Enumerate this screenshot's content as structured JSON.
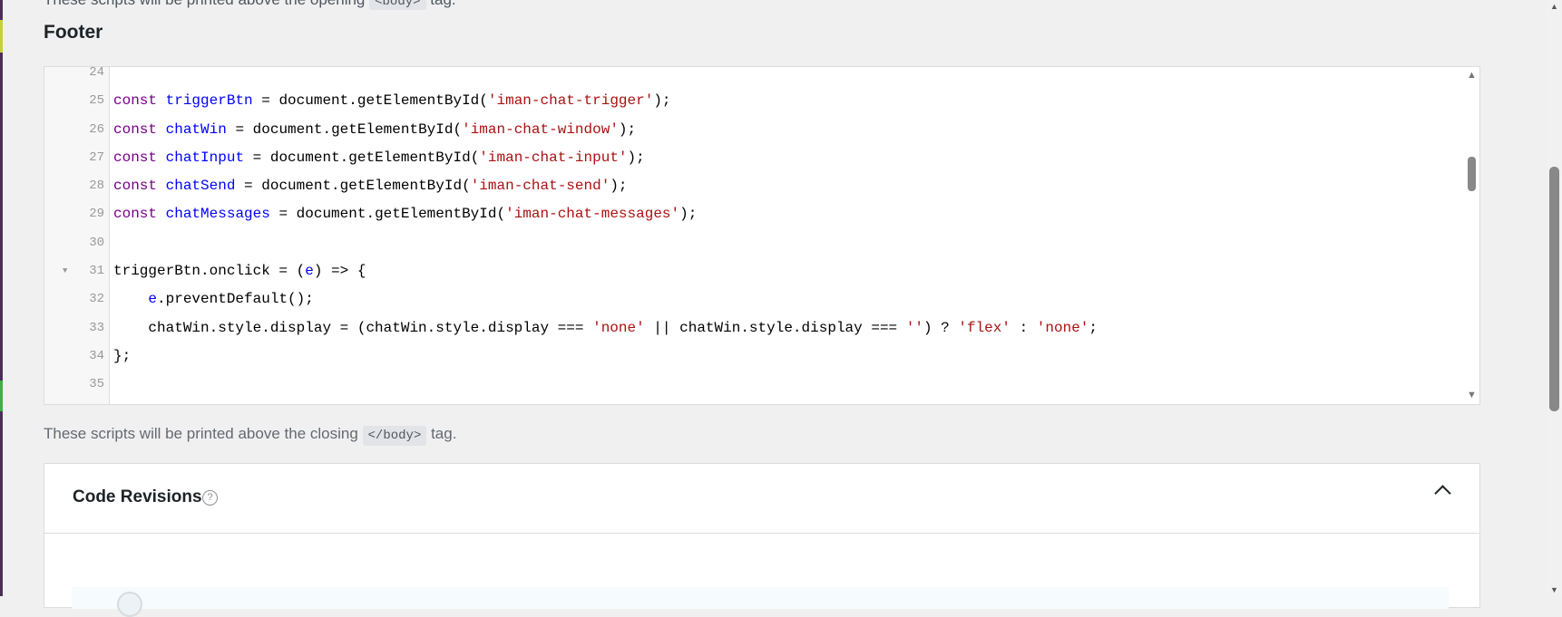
{
  "top_partial": {
    "text": "These scripts will be printed above the opening",
    "code": "<body>",
    "suffix": "tag."
  },
  "section_title": "Footer",
  "editor": {
    "lines": [
      {
        "num": "24",
        "fold": false,
        "tokens": []
      },
      {
        "num": "25",
        "fold": false,
        "tokens": [
          {
            "t": "const",
            "c": "kw"
          },
          {
            "t": " "
          },
          {
            "t": "triggerBtn",
            "c": "def"
          },
          {
            "t": " = document.getElementById("
          },
          {
            "t": "'iman-chat-trigger'",
            "c": "str"
          },
          {
            "t": ");"
          }
        ]
      },
      {
        "num": "26",
        "fold": false,
        "tokens": [
          {
            "t": "const",
            "c": "kw"
          },
          {
            "t": " "
          },
          {
            "t": "chatWin",
            "c": "def"
          },
          {
            "t": " = document.getElementById("
          },
          {
            "t": "'iman-chat-window'",
            "c": "str"
          },
          {
            "t": ");"
          }
        ]
      },
      {
        "num": "27",
        "fold": false,
        "tokens": [
          {
            "t": "const",
            "c": "kw"
          },
          {
            "t": " "
          },
          {
            "t": "chatInput",
            "c": "def"
          },
          {
            "t": " = document.getElementById("
          },
          {
            "t": "'iman-chat-input'",
            "c": "str"
          },
          {
            "t": ");"
          }
        ]
      },
      {
        "num": "28",
        "fold": false,
        "tokens": [
          {
            "t": "const",
            "c": "kw"
          },
          {
            "t": " "
          },
          {
            "t": "chatSend",
            "c": "def"
          },
          {
            "t": " = document.getElementById("
          },
          {
            "t": "'iman-chat-send'",
            "c": "str"
          },
          {
            "t": ");"
          }
        ]
      },
      {
        "num": "29",
        "fold": false,
        "tokens": [
          {
            "t": "const",
            "c": "kw"
          },
          {
            "t": " "
          },
          {
            "t": "chatMessages",
            "c": "def"
          },
          {
            "t": " = document.getElementById("
          },
          {
            "t": "'iman-chat-messages'",
            "c": "str"
          },
          {
            "t": ");"
          }
        ]
      },
      {
        "num": "30",
        "fold": false,
        "tokens": []
      },
      {
        "num": "31",
        "fold": true,
        "tokens": [
          {
            "t": "triggerBtn.onclick = ("
          },
          {
            "t": "e",
            "c": "def"
          },
          {
            "t": ") => {"
          }
        ]
      },
      {
        "num": "32",
        "fold": false,
        "tokens": [
          {
            "t": "    "
          },
          {
            "t": "e",
            "c": "def"
          },
          {
            "t": ".preventDefault();"
          }
        ]
      },
      {
        "num": "33",
        "fold": false,
        "tokens": [
          {
            "t": "    chatWin.style.display = (chatWin.style.display === "
          },
          {
            "t": "'none'",
            "c": "str"
          },
          {
            "t": " || chatWin.style.display === "
          },
          {
            "t": "''",
            "c": "str"
          },
          {
            "t": ") ? "
          },
          {
            "t": "'flex'",
            "c": "str"
          },
          {
            "t": " : "
          },
          {
            "t": "'none'",
            "c": "str"
          },
          {
            "t": ";"
          }
        ]
      },
      {
        "num": "34",
        "fold": false,
        "tokens": [
          {
            "t": "};"
          }
        ]
      },
      {
        "num": "35",
        "fold": false,
        "tokens": []
      }
    ]
  },
  "help": {
    "text": "These scripts will be printed above the closing",
    "code": "</body>",
    "suffix": "tag."
  },
  "revisions": {
    "title": "Code Revisions"
  },
  "icons": {
    "fold": "fold-arrow-icon",
    "help": "question-circle-icon",
    "collapse": "chevron-up-icon"
  },
  "colors": {
    "keyword": "#770088",
    "definition": "#0000ff",
    "string": "#aa1111"
  }
}
